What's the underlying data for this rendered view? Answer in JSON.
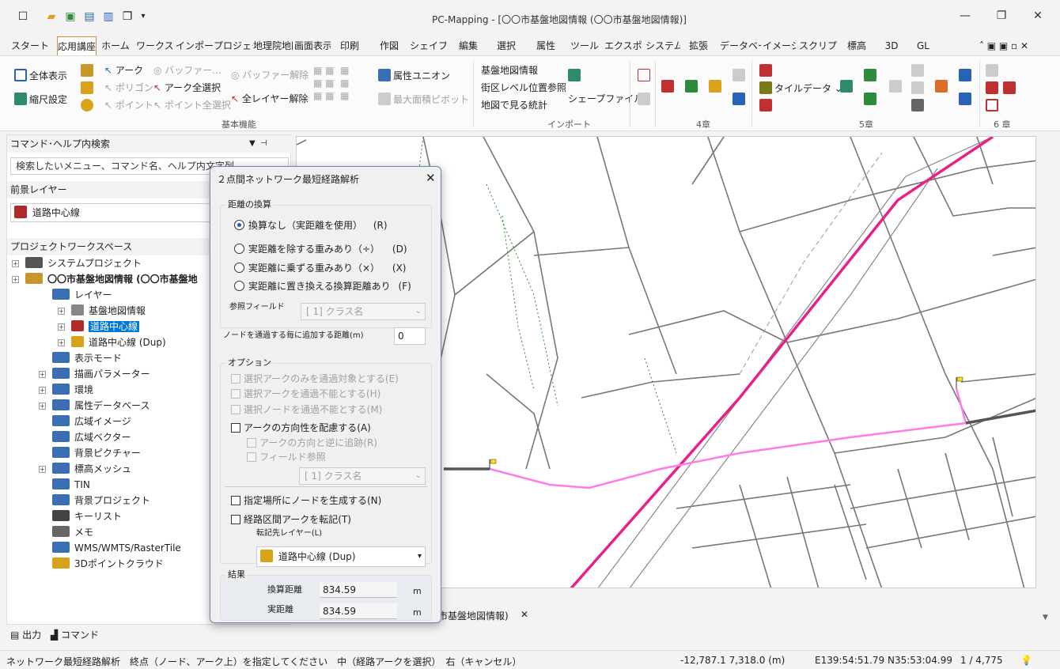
{
  "window": {
    "title": "PC-Mapping - [〇〇市基盤地図情報 (〇〇市基盤地図情報)]"
  },
  "tabs": [
    "スタート",
    "応用講座",
    "ホーム",
    "ワークスペース",
    "インポート",
    "プロジェクト",
    "地理院地図",
    "画面表示",
    "印刷",
    "作図",
    "シェイプ",
    "編集",
    "選択",
    "属性",
    "ツール",
    "エクスポート",
    "システム",
    "拡張",
    "データベース",
    "イメージ",
    "スクリプト",
    "標高",
    "3D",
    "GL"
  ],
  "ribbon": {
    "zenhyoji": "全体表示",
    "shukusyaku": "縮尺設定",
    "arc": "アーク",
    "polygon": "ポリゴン",
    "point": "ポイント",
    "buffer": "バッファー...",
    "arc_all": "アーク全選択",
    "point_all": "ポイント全選択",
    "buffer_clear": "バッファー解除",
    "all_layer_clear": "全レイヤー解除",
    "attr_union": "属性ユニオン",
    "max_area_pivot": "最大面積ピボット",
    "group_basic": "基本機能",
    "kiban": "基盤地図情報",
    "gaiku": "街区レベル位置参照",
    "toukei": "地図で見る統計",
    "shape": "シェープファイル",
    "group_import": "インポート",
    "tile": "タイルデータ",
    "group_4": "4章",
    "group_5": "5章",
    "group_6": "6 章"
  },
  "left": {
    "search_title": "コマンド･ヘルプ内検索",
    "search_placeholder": "検索したいメニュー、コマンド名、ヘルプ内文字列",
    "fg_title": "前景レイヤー",
    "fg_value": "道路中心線",
    "pw_title": "プロジェクトワークスペース",
    "tree": [
      "システムプロジェクト",
      "〇〇市基盤地図情報 (〇〇市基盤地",
      "レイヤー",
      "基盤地図情報",
      "道路中心線",
      "道路中心線 (Dup)",
      "表示モード",
      "描画パラメーター",
      "環境",
      "属性データベース",
      "広域イメージ",
      "広域ベクター",
      "背景ピクチャー",
      "標高メッシュ",
      "TIN",
      "背景プロジェクト",
      "キーリスト",
      "メモ",
      "WMS/WMTS/RasterTile",
      "3Dポイントクラウド"
    ],
    "bottom_output": "出力",
    "bottom_command": "コマンド"
  },
  "doc_tab": "市基盤地図情報)",
  "dialog": {
    "title": "２点間ネットワーク最短経路解析",
    "sec_conv": "距離の換算",
    "r1": "換算なし（実距離を使用）",
    "r1k": "(R)",
    "r2": "実距離を除する重みあり（÷）",
    "r2k": "(D)",
    "r3": "実距離に乗ずる重みあり（×）",
    "r3k": "(X)",
    "r4": "実距離に置き換える換算距離あり",
    "r4k": "(F)",
    "ref_field": "参照フィールド",
    "ref_value": "[ 1] クラス名",
    "node_add": "ノードを通過する毎に追加する距離(m)",
    "node_add_value": "0",
    "sec_opt": "オプション",
    "c1": "選択アークのみを通過対象とする(E)",
    "c2": "選択アークを通過不能とする(H)",
    "c3": "選択ノードを通過不能とする(M)",
    "c4": "アークの方向性を配慮する(A)",
    "c5": "アークの方向と逆に追跡(R)",
    "c6": "フィールド参照",
    "c6_value": "[ 1] クラス名",
    "c7": "指定場所にノードを生成する(N)",
    "c8": "経路区間アークを転記(T)",
    "transfer_label": "転記先レイヤー(L)",
    "transfer_value": "道路中心線 (Dup)",
    "sec_result": "結果",
    "res1": "換算距離",
    "res1_value": "834.59",
    "res2": "実距離",
    "res2_value": "834.59",
    "unit": "m"
  },
  "status": {
    "msg": "ネットワーク最短経路解析　終点（ノード、アーク上）を指定してください　中（経路アークを選択）　右（キャンセル）",
    "coord": "-12,787.1 7,318.0 (m)",
    "latlon": "E139:54:51.79 N35:53:04.99",
    "page": "1 / 4,775"
  },
  "colors": {
    "accent": "#d08a3a",
    "route": "#ff7ce6",
    "rail": "#e8208a",
    "select": "#0078d7"
  }
}
